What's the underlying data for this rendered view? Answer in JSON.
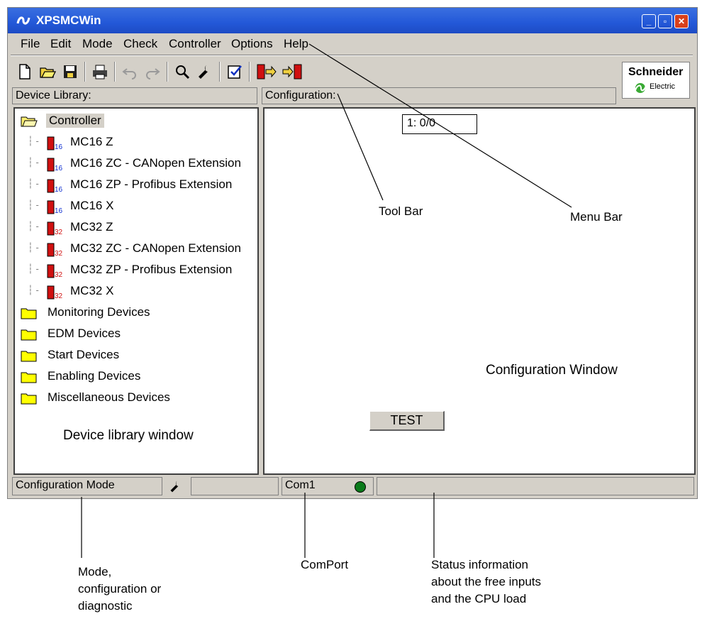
{
  "window": {
    "title": "XPSMCWin"
  },
  "menu": [
    "File",
    "Edit",
    "Mode",
    "Check",
    "Controller",
    "Options",
    "Help"
  ],
  "toolbar": {
    "icons": [
      "new-file-icon",
      "open-folder-icon",
      "save-icon",
      "print-icon",
      "undo-icon",
      "redo-icon",
      "search-icon",
      "wrench-icon",
      "check-config-icon",
      "connect-icon",
      "disconnect-icon"
    ]
  },
  "brand": {
    "name": "Schneider",
    "sub": "Electric"
  },
  "device_library": {
    "header": "Device Library:",
    "root": "Controller",
    "controllers": [
      {
        "label": "MC16 Z",
        "badge": "16"
      },
      {
        "label": "MC16 ZC - CANopen Extension",
        "badge": "16"
      },
      {
        "label": "MC16 ZP - Profibus Extension",
        "badge": "16"
      },
      {
        "label": "MC16 X",
        "badge": "16"
      },
      {
        "label": "MC32 Z",
        "badge": "32"
      },
      {
        "label": "MC32 ZC - CANopen Extension",
        "badge": "32"
      },
      {
        "label": "MC32 ZP - Profibus Extension",
        "badge": "32"
      },
      {
        "label": "MC32 X",
        "badge": "32"
      }
    ],
    "folders": [
      "Monitoring Devices",
      "EDM Devices",
      "Start Devices",
      "Enabling Devices",
      "Miscellaneous Devices"
    ],
    "caption": "Device library window"
  },
  "configuration": {
    "header": "Configuration:",
    "address": "1: 0/0",
    "caption": "Configuration Window",
    "test_button": "TEST"
  },
  "status": {
    "mode": "Configuration Mode",
    "com": "Com1",
    "led_color": "#0a7a1a"
  },
  "annotations": {
    "tool_bar": "Tool Bar",
    "menu_bar": "Menu Bar",
    "mode_1": "Mode,",
    "mode_2": "configuration or",
    "mode_3": "diagnostic",
    "comport": "ComPort",
    "status_1": "Status information",
    "status_2": "about the free inputs",
    "status_3": "and the CPU load"
  }
}
